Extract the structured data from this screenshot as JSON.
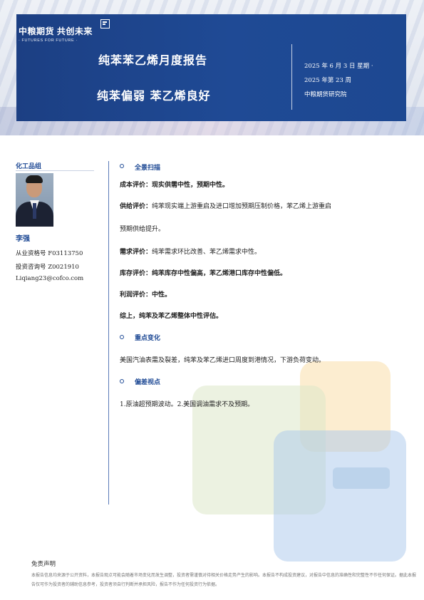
{
  "header": {
    "logo_text": "中粮期货  共创未来",
    "logo_sub": "· FUTURES FOR FUTURE ·",
    "report_title": "纯苯苯乙烯月度报告",
    "report_subtitle": "纯苯偏弱  苯乙烯良好",
    "date": "2025 年 6 月 3 日  星期  ·",
    "week": "2025 年第 23 周",
    "institute": "中粮期货研究院"
  },
  "analyst": {
    "team": "化工品组",
    "name": "李强",
    "qualification": "从业资格号  F03113750",
    "advisor": "投资咨询号  Z0021910",
    "email": "Liqiang23@cofco.com"
  },
  "sections": {
    "overview": {
      "title": "全景扫描",
      "cost_label": "成本评价：",
      "cost_text": "现实供需中性，预期中性。",
      "supply_label": "供给评价：",
      "supply_text": "纯苯现实端上游重启及进口增加预期压制价格，苯乙烯上游重启",
      "supply_text2": "预期供给提升。",
      "demand_label": "需求评价：",
      "demand_text": "纯苯需求环比改善、苯乙烯需求中性。",
      "inventory_label": "库存评价：",
      "inventory_text": "纯苯库存中性偏高，苯乙烯港口库存中性偏低。",
      "profit_label": "利润评价：",
      "profit_text": "中性。",
      "summary": "综上，纯苯及苯乙烯整体中性评估。"
    },
    "changes": {
      "title": "重点变化",
      "text": "美国汽油表需及裂差，纯苯及苯乙烯进口周度到港情况，下游负荷变动。"
    },
    "risks": {
      "title": "偏差视点",
      "text": "1.原油超预期波动。2.美国调油需求不及预期。"
    }
  },
  "footer": {
    "disclaimer_title": "免责声明",
    "disclaimer_text": "本报告信息均来源于公开资料，本报告观点可能会随着市场变化而发生调整，投资者需谨慎对待相关价格走势产生的影响。本报告不构成投资建议，对报告中信息的准确性和完整性不作任何保证。据此本报告仅可作为投资者的辅助信息参考，投资者须自行判断并承担风险，报告不作为任何投资行为依据。"
  },
  "colors": {
    "brand_blue": "#1f4a95",
    "header_blue": "#1c3f83"
  }
}
